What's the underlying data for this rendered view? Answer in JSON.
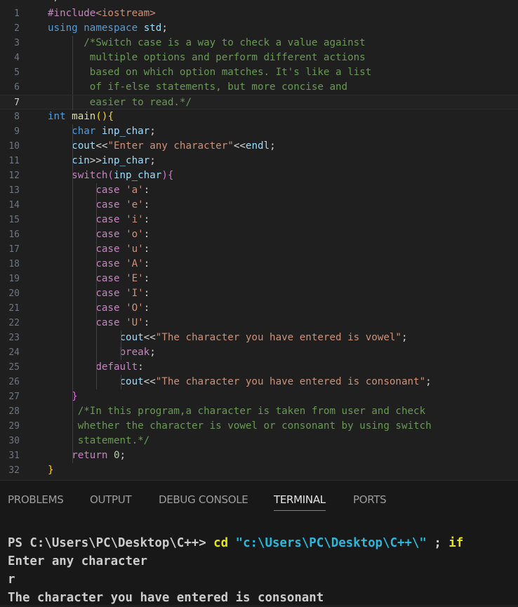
{
  "editor": {
    "partial_line_text": "  ;++",
    "lines": [
      {
        "n": "1",
        "tokens": [
          [
            "inc",
            "#include"
          ],
          [
            "hdr",
            "<iostream>"
          ]
        ]
      },
      {
        "n": "2",
        "tokens": [
          [
            "k",
            "using"
          ],
          [
            "p",
            " "
          ],
          [
            "k",
            "namespace"
          ],
          [
            "p",
            " "
          ],
          [
            "id",
            "std"
          ],
          [
            "p",
            ";"
          ]
        ]
      },
      {
        "n": "3",
        "tokens": [
          [
            "p",
            "      "
          ],
          [
            "c",
            "/*Switch case is a way to check a value against"
          ]
        ]
      },
      {
        "n": "4",
        "tokens": [
          [
            "c",
            "       multiple options and perform different actions"
          ]
        ]
      },
      {
        "n": "5",
        "tokens": [
          [
            "c",
            "       based on which option matches. It's like a list"
          ]
        ]
      },
      {
        "n": "6",
        "tokens": [
          [
            "c",
            "       of if-else statements, but more concise and"
          ]
        ]
      },
      {
        "n": "7",
        "tokens": [
          [
            "c",
            "       easier to read.*/"
          ]
        ],
        "current": true
      },
      {
        "n": "8",
        "tokens": [
          [
            "k",
            "int"
          ],
          [
            "p",
            " "
          ],
          [
            "fn",
            "main"
          ],
          [
            "b1",
            "()"
          ],
          [
            "b1",
            "{"
          ]
        ]
      },
      {
        "n": "9",
        "tokens": [
          [
            "p",
            "    "
          ],
          [
            "k",
            "char"
          ],
          [
            "p",
            " "
          ],
          [
            "id",
            "inp_char"
          ],
          [
            "p",
            ";"
          ]
        ]
      },
      {
        "n": "10",
        "tokens": [
          [
            "p",
            "    "
          ],
          [
            "id",
            "cout"
          ],
          [
            "op",
            "<<"
          ],
          [
            "s",
            "\"Enter any character\""
          ],
          [
            "op",
            "<<"
          ],
          [
            "id",
            "endl"
          ],
          [
            "p",
            ";"
          ]
        ]
      },
      {
        "n": "11",
        "tokens": [
          [
            "p",
            "    "
          ],
          [
            "id",
            "cin"
          ],
          [
            "op",
            ">>"
          ],
          [
            "id",
            "inp_char"
          ],
          [
            "p",
            ";"
          ]
        ]
      },
      {
        "n": "12",
        "tokens": [
          [
            "p",
            "    "
          ],
          [
            "ctl",
            "switch"
          ],
          [
            "b2",
            "("
          ],
          [
            "id",
            "inp_char"
          ],
          [
            "b2",
            ")"
          ],
          [
            "b2",
            "{"
          ]
        ]
      },
      {
        "n": "13",
        "tokens": [
          [
            "p",
            "        "
          ],
          [
            "ctl",
            "case"
          ],
          [
            "p",
            " "
          ],
          [
            "s",
            "'a'"
          ],
          [
            "p",
            ":"
          ]
        ]
      },
      {
        "n": "14",
        "tokens": [
          [
            "p",
            "        "
          ],
          [
            "ctl",
            "case"
          ],
          [
            "p",
            " "
          ],
          [
            "s",
            "'e'"
          ],
          [
            "p",
            ":"
          ]
        ]
      },
      {
        "n": "15",
        "tokens": [
          [
            "p",
            "        "
          ],
          [
            "ctl",
            "case"
          ],
          [
            "p",
            " "
          ],
          [
            "s",
            "'i'"
          ],
          [
            "p",
            ":"
          ]
        ]
      },
      {
        "n": "16",
        "tokens": [
          [
            "p",
            "        "
          ],
          [
            "ctl",
            "case"
          ],
          [
            "p",
            " "
          ],
          [
            "s",
            "'o'"
          ],
          [
            "p",
            ":"
          ]
        ]
      },
      {
        "n": "17",
        "tokens": [
          [
            "p",
            "        "
          ],
          [
            "ctl",
            "case"
          ],
          [
            "p",
            " "
          ],
          [
            "s",
            "'u'"
          ],
          [
            "p",
            ":"
          ]
        ]
      },
      {
        "n": "18",
        "tokens": [
          [
            "p",
            "        "
          ],
          [
            "ctl",
            "case"
          ],
          [
            "p",
            " "
          ],
          [
            "s",
            "'A'"
          ],
          [
            "p",
            ":"
          ]
        ]
      },
      {
        "n": "19",
        "tokens": [
          [
            "p",
            "        "
          ],
          [
            "ctl",
            "case"
          ],
          [
            "p",
            " "
          ],
          [
            "s",
            "'E'"
          ],
          [
            "p",
            ":"
          ]
        ]
      },
      {
        "n": "20",
        "tokens": [
          [
            "p",
            "        "
          ],
          [
            "ctl",
            "case"
          ],
          [
            "p",
            " "
          ],
          [
            "s",
            "'I'"
          ],
          [
            "p",
            ":"
          ]
        ]
      },
      {
        "n": "21",
        "tokens": [
          [
            "p",
            "        "
          ],
          [
            "ctl",
            "case"
          ],
          [
            "p",
            " "
          ],
          [
            "s",
            "'O'"
          ],
          [
            "p",
            ":"
          ]
        ]
      },
      {
        "n": "22",
        "tokens": [
          [
            "p",
            "        "
          ],
          [
            "ctl",
            "case"
          ],
          [
            "p",
            " "
          ],
          [
            "s",
            "'U'"
          ],
          [
            "p",
            ":"
          ]
        ]
      },
      {
        "n": "23",
        "tokens": [
          [
            "p",
            "            "
          ],
          [
            "id",
            "cout"
          ],
          [
            "op",
            "<<"
          ],
          [
            "s",
            "\"The character you have entered is vowel\""
          ],
          [
            "p",
            ";"
          ]
        ]
      },
      {
        "n": "24",
        "tokens": [
          [
            "p",
            "            "
          ],
          [
            "ctl",
            "break"
          ],
          [
            "p",
            ";"
          ]
        ]
      },
      {
        "n": "25",
        "tokens": [
          [
            "p",
            "        "
          ],
          [
            "ctl",
            "default"
          ],
          [
            "p",
            ":"
          ]
        ]
      },
      {
        "n": "26",
        "tokens": [
          [
            "p",
            "            "
          ],
          [
            "id",
            "cout"
          ],
          [
            "op",
            "<<"
          ],
          [
            "s",
            "\"The character you have entered is consonant\""
          ],
          [
            "p",
            ";"
          ]
        ]
      },
      {
        "n": "27",
        "tokens": [
          [
            "p",
            "    "
          ],
          [
            "b2",
            "}"
          ]
        ]
      },
      {
        "n": "28",
        "tokens": [
          [
            "p",
            "     "
          ],
          [
            "c",
            "/*In this program,a character is taken from user and check"
          ]
        ]
      },
      {
        "n": "29",
        "tokens": [
          [
            "c",
            "     whether the character is vowel or consonant by using switch"
          ]
        ]
      },
      {
        "n": "30",
        "tokens": [
          [
            "c",
            "     statement.*/"
          ]
        ]
      },
      {
        "n": "31",
        "tokens": [
          [
            "p",
            "    "
          ],
          [
            "ctl",
            "return"
          ],
          [
            "p",
            " "
          ],
          [
            "n",
            "0"
          ],
          [
            "p",
            ";"
          ]
        ]
      },
      {
        "n": "32",
        "tokens": [
          [
            "b1",
            "}"
          ]
        ]
      }
    ]
  },
  "panel": {
    "tabs": [
      "PROBLEMS",
      "OUTPUT",
      "DEBUG CONSOLE",
      "TERMINAL",
      "PORTS"
    ],
    "active_tab": "TERMINAL",
    "terminal": {
      "prompt": "PS C:\\Users\\PC\\Desktop\\C++> ",
      "command": "cd",
      "path_arg": "\"c:\\Users\\PC\\Desktop\\C++\\\"",
      "separator": " ; ",
      "next_command": "if",
      "output_lines": [
        "Enter any character",
        "r",
        "The character you have entered is consonant"
      ]
    }
  },
  "colors": {
    "editor_bg": "#1f1f1f",
    "panel_bg": "#181818",
    "active_tab_underline": "#3794ff",
    "comment": "#6a9955",
    "string": "#ce9178",
    "keyword": "#569cd6",
    "control": "#c586c0",
    "variable": "#9cdcfe"
  }
}
